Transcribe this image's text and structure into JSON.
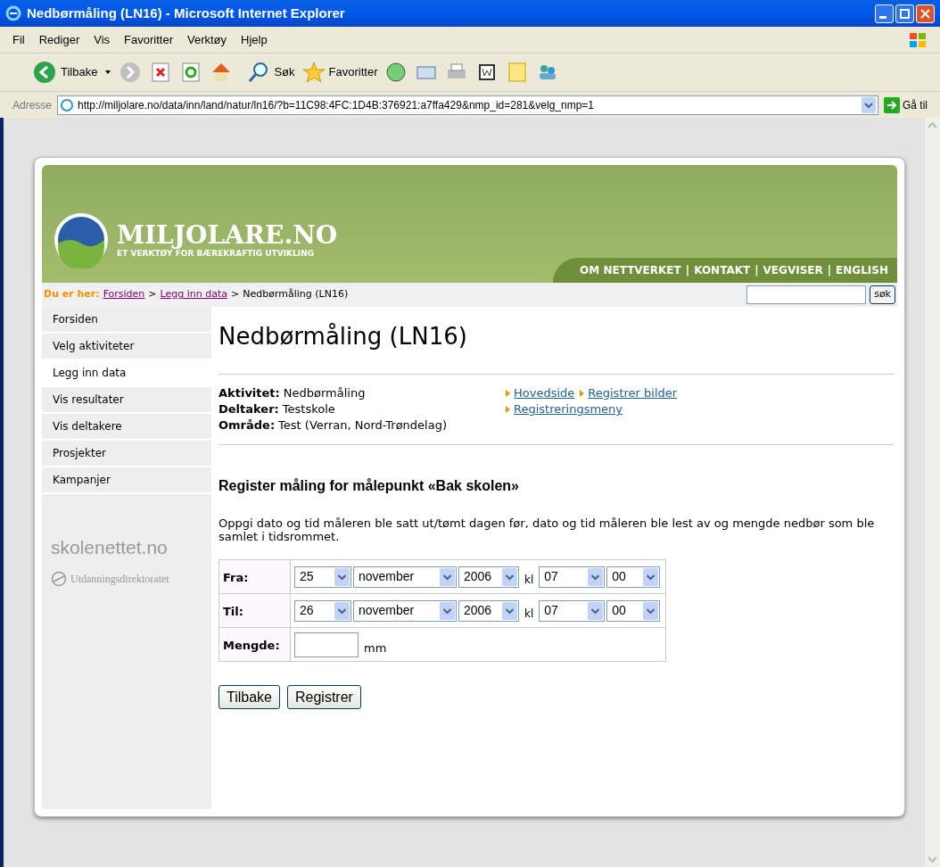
{
  "window": {
    "title": "Nedbørmåling (LN16) - Microsoft Internet Explorer"
  },
  "menu_bar": [
    "Fil",
    "Rediger",
    "Vis",
    "Favoritter",
    "Verktøy",
    "Hjelp"
  ],
  "toolbar": {
    "back": "Tilbake",
    "search": "Søk",
    "favorites": "Favoritter"
  },
  "address_bar": {
    "label": "Adresse",
    "url": "http://miljolare.no/data/inn/land/natur/ln16/?b=11C98:4FC:1D4B:376921:a7ffa429&nmp_id=281&velg_nmp=1",
    "go": "Gå til"
  },
  "header": {
    "logo_title": "MILJOLARE.NO",
    "logo_subtitle": "ET VERKTØY FOR BÆREKRAFTIG UTVIKLING",
    "links": [
      "OM NETTVERKET",
      "KONTAKT",
      "VEGVISER",
      "ENGLISH"
    ],
    "separator": "|"
  },
  "breadcrumb": {
    "label": "Du er her:",
    "links": [
      "Forsiden",
      "Legg inn data"
    ],
    "separator": ">",
    "current": "Nedbørmåling (LN16)",
    "search_button": "søk"
  },
  "sidebar": {
    "items": [
      {
        "label": "Forsiden",
        "selected": false
      },
      {
        "label": "Velg aktiviteter",
        "selected": false
      },
      {
        "label": "Legg inn data",
        "selected": true
      },
      {
        "label": "Vis resultater",
        "selected": false
      },
      {
        "label": "Vis deltakere",
        "selected": false
      },
      {
        "label": "Prosjekter",
        "selected": false
      },
      {
        "label": "Kampanjer",
        "selected": false
      }
    ],
    "logo_primary": "skolenettet.no",
    "logo_secondary": "Utdanningsdirektoratet"
  },
  "page": {
    "title": "Nedbørmåling (LN16)",
    "info": [
      {
        "label": "Aktivitet:",
        "value": "Nedbørmåling"
      },
      {
        "label": "Deltaker:",
        "value": "Testskole"
      },
      {
        "label": "Område:",
        "value": "Test (Verran, Nord-Trøndelag)"
      }
    ],
    "links": [
      [
        "Hovedside",
        "Registrer bilder"
      ],
      [
        "Registreringsmeny"
      ]
    ],
    "heading": "Register måling for målepunkt «Bak skolen»",
    "description": "Oppgi dato og tid måleren ble satt ut/tømt dagen før, dato og tid måleren ble lest av og mengde nedbør som ble samlet i tidsrommet.",
    "form_rows": [
      {
        "kind": "datetime",
        "label": "Fra:",
        "day": "25",
        "month": "november",
        "year": "2006",
        "kl": "kl",
        "hour": "07",
        "minute": "00"
      },
      {
        "kind": "datetime",
        "label": "Til:",
        "day": "26",
        "month": "november",
        "year": "2006",
        "kl": "kl",
        "hour": "07",
        "minute": "00"
      },
      {
        "kind": "amount",
        "label": "Mengde:",
        "unit": "mm"
      }
    ],
    "buttons": [
      "Tilbake",
      "Registrer"
    ]
  }
}
